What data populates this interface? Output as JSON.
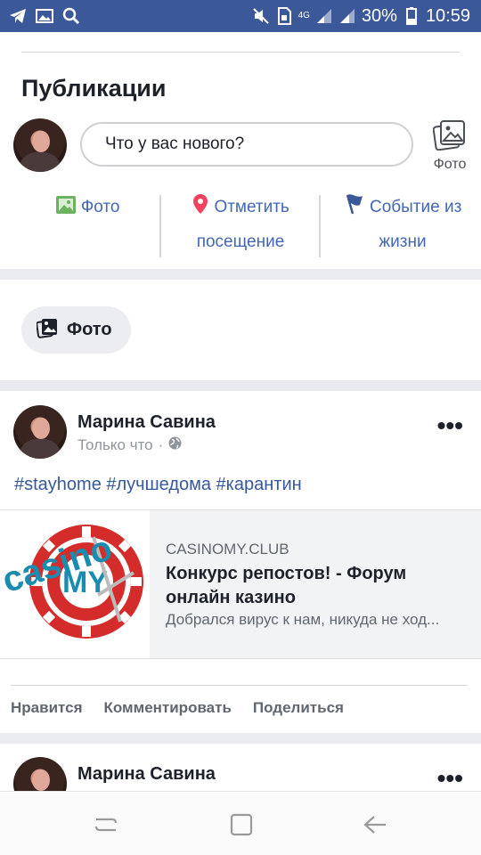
{
  "status_bar": {
    "battery": "30%",
    "time": "10:59",
    "network": "4G",
    "icons": [
      "telegram-icon",
      "image-icon",
      "search-icon",
      "mute-icon",
      "sim-icon",
      "signal-icon",
      "signal-icon-2",
      "battery-icon"
    ]
  },
  "publications": {
    "title": "Публикации",
    "composer_placeholder": "Что у вас нового?",
    "photo_side_label": "Фото",
    "actions": [
      {
        "icon": "photo-icon",
        "label_line1": "Фото",
        "label_line2": ""
      },
      {
        "icon": "location-pin-icon",
        "label_line1": "Отметить",
        "label_line2": "посещение"
      },
      {
        "icon": "flag-icon",
        "label_line1": "Событие из",
        "label_line2": "жизни"
      }
    ]
  },
  "photo_chip": {
    "label": "Фото"
  },
  "post1": {
    "author": "Марина Савина",
    "time": "Только что",
    "visibility_icon": "globe-icon",
    "text": "#stayhome #лучшедома #карантин",
    "link": {
      "domain": "CASINOMY.CLUB",
      "title": "Конкурс репостов! - Форум онлайн казино",
      "description": "Добрался вирус к нам, никуда не ход..."
    },
    "actions": [
      "Нравится",
      "Комментировать",
      "Поделиться"
    ]
  },
  "post2": {
    "author": "Марина Савина"
  },
  "colors": {
    "status_bar": "#3b5998",
    "link_blue": "#4267b2",
    "hashtag": "#365899",
    "chip_bg": "#ebedf0"
  }
}
